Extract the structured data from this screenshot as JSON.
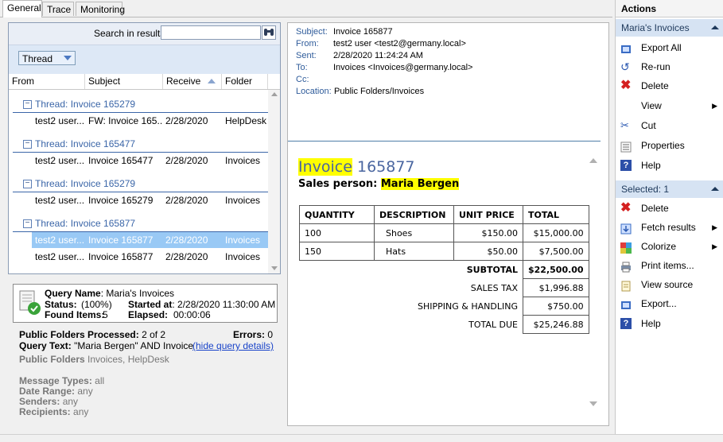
{
  "tabs": [
    "General",
    "Trace",
    "Monitoring"
  ],
  "search": {
    "label": "Search in results",
    "value": ""
  },
  "group_by": "Thread",
  "columns": [
    "From",
    "Subject",
    "Receive",
    "Folder"
  ],
  "threads": [
    {
      "title": "Thread: Invoice 165279",
      "rows": [
        {
          "from": "test2 user...",
          "subject": "FW: Invoice 165...",
          "received": "2/28/2020",
          "folder": "HelpDesk"
        }
      ]
    },
    {
      "title": "Thread: Invoice 165477",
      "rows": [
        {
          "from": "test2 user...",
          "subject": "Invoice 165477",
          "received": "2/28/2020",
          "folder": "Invoices"
        }
      ]
    },
    {
      "title": "Thread: Invoice 165279",
      "rows": [
        {
          "from": "test2 user...",
          "subject": "Invoice 165279",
          "received": "2/28/2020",
          "folder": "Invoices"
        }
      ]
    },
    {
      "title": "Thread: Invoice 165877",
      "rows": [
        {
          "from": "test2 user...",
          "subject": "Invoice 165877",
          "received": "2/28/2020",
          "folder": "Invoices",
          "selected": true
        },
        {
          "from": "test2 user...",
          "subject": "Invoice 165877",
          "received": "2/28/2020",
          "folder": "Invoices"
        }
      ]
    }
  ],
  "query": {
    "name_label": "Query Name",
    "name": "Maria's Invoices",
    "status_label": "Status:",
    "status": "(100%)",
    "found_label": "Found Items:",
    "found": "5",
    "started_label": "Started at",
    "started": "2/28/2020 11:30:00 AM",
    "elapsed_label": "Elapsed:",
    "elapsed": "00:00:06",
    "pf_processed_label": "Public Folders Processed:",
    "pf_processed": "2 of 2",
    "errors_label": "Errors:",
    "errors": "0",
    "text_label": "Query Text:",
    "text": "\"Maria Bergen\" AND Invoice",
    "hide_link": "(hide query details)",
    "pf_label": "Public Folders",
    "pf": "Invoices, HelpDesk",
    "msg_types_label": "Message Types:",
    "msg_types": "all",
    "date_range_label": "Date Range:",
    "date_range": "any",
    "senders_label": "Senders:",
    "senders": "any",
    "recipients_label": "Recipients:",
    "recipients": "any"
  },
  "message": {
    "subject_label": "Subject:",
    "subject": "Invoice 165877",
    "from_label": "From:",
    "from": "test2 user <test2@germany.local>",
    "sent_label": "Sent:",
    "sent": "2/28/2020 11:24:24 AM",
    "to_label": "To:",
    "to": "Invoices <Invoices@germany.local>",
    "cc_label": "Cc:",
    "cc": "",
    "location_label": "Location:",
    "location": "Public Folders/Invoices"
  },
  "invoice": {
    "title_hl": "Invoice",
    "title_num": "165877",
    "salesperson_label": "Sales person:",
    "salesperson": "Maria Bergen",
    "headers": [
      "QUANTITY",
      "DESCRIPTION",
      "UNIT PRICE",
      "TOTAL"
    ],
    "lines": [
      {
        "qty": "100",
        "desc": "Shoes",
        "price": "$150.00",
        "total": "$15,000.00"
      },
      {
        "qty": "150",
        "desc": "Hats",
        "price": "$50.00",
        "total": "$7,500.00"
      }
    ],
    "subtotal_label": "SUBTOTAL",
    "subtotal": "$22,500.00",
    "tax_label": "SALES TAX",
    "tax": "$1,996.88",
    "shipping_label": "SHIPPING & HANDLING",
    "shipping": "$750.00",
    "due_label": "TOTAL DUE",
    "due": "$25,246.88"
  },
  "actions": {
    "title": "Actions",
    "section1": "Maria's Invoices",
    "items1": [
      "Export All",
      "Re-run",
      "Delete",
      "View",
      "Cut",
      "Properties",
      "Help"
    ],
    "section2": "Selected: 1",
    "items2": [
      "Delete",
      "Fetch results",
      "Colorize",
      "Print items...",
      "View source",
      "Export...",
      "Help"
    ]
  },
  "colors": {
    "highlight": "#ffff00",
    "selection": "#99c9f5",
    "thread_blue": "#3b66a8",
    "section_bg": "#d6e3f3"
  }
}
